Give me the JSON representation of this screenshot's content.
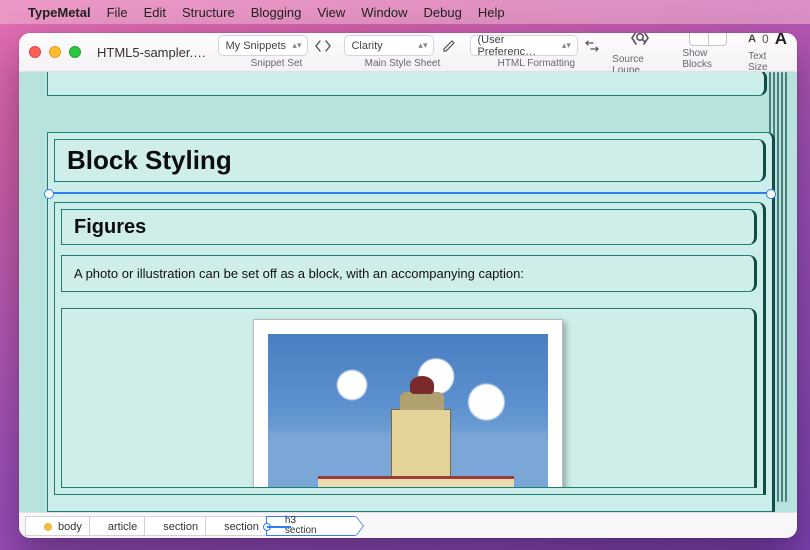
{
  "menubar": {
    "app": "TypeMetal",
    "items": [
      "File",
      "Edit",
      "Structure",
      "Blogging",
      "View",
      "Window",
      "Debug",
      "Help"
    ]
  },
  "window": {
    "title": "HTML5-sampler.ht…"
  },
  "toolbar": {
    "snippet": {
      "value": "My Snippets",
      "label": "Snippet Set"
    },
    "stylesheet": {
      "value": "Clarity",
      "label": "Main Style Sheet"
    },
    "formatting": {
      "value": "(User Preferenc…",
      "label": "HTML Formatting"
    },
    "loupe_label": "Source Loupe",
    "showblocks_label": "Show Blocks",
    "textsize_label": "Text Size",
    "textsize_value": "0"
  },
  "content": {
    "h2": "Block Styling",
    "h3": "Figures",
    "para": "A photo or illustration can be set off as a block, with an accompanying caption:"
  },
  "breadcrumb": {
    "items": [
      "body",
      "article",
      "section",
      "section"
    ],
    "tail_top": "h3",
    "tail_bottom": "section"
  }
}
